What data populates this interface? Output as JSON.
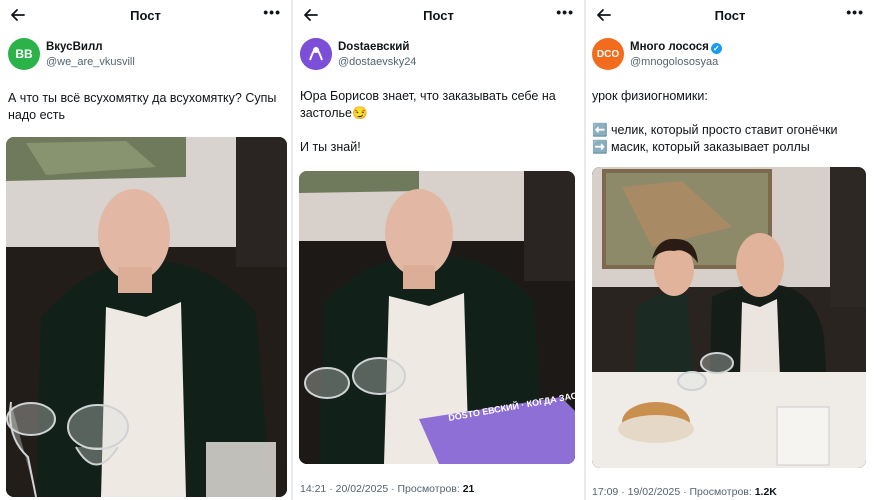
{
  "header": {
    "title": "Пост"
  },
  "colors": {
    "avatar1": "#2bb34a",
    "avatar2": "#7b4fd8",
    "avatar3": "#f36b1c",
    "verified": "#1d9bf0",
    "box_purple": "#8e6fd6"
  },
  "posts": [
    {
      "author_name": "ВкусВилл",
      "author_handle": "@we_are_vkusvill",
      "avatar_text": "BB",
      "lines": [
        "А что ты всё всухомятку да всухомятку? Супы надо есть"
      ]
    },
    {
      "author_name": "Dostaевский",
      "author_handle": "@dostaevsky24",
      "lines": [
        "Юра Борисов знает, что заказывать себе на застолье😏",
        "",
        "И ты знай!"
      ],
      "time": "14:21 · 20/02/2025 · Просмотров: ",
      "views": "21",
      "box_text": "DOSTO ЕВСКИЙ · КОГДА ЗАСТАВИЛ ДРУЗЕЙ СМОТРЕТЬ СВОЙ СЕРИАЛ"
    },
    {
      "author_name": "Много лосося",
      "author_handle": "@mnogolososyaa",
      "avatar_text": "DCO",
      "lines": [
        "урок физиогномики:",
        "",
        "⬅️ челик, который просто ставит огонёчки",
        "➡️ масик, который заказывает роллы"
      ],
      "time": "17:09 · 19/02/2025 · Просмотров: ",
      "views": "1.2K"
    }
  ]
}
